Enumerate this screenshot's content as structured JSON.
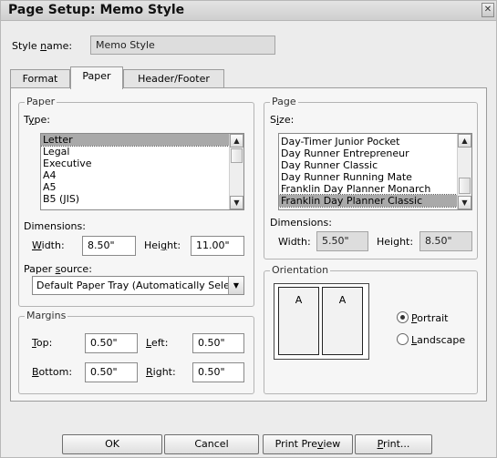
{
  "window": {
    "title": "Page Setup: Memo Style",
    "close_glyph": "✕"
  },
  "style_name": {
    "label_pre": "Style ",
    "label_u": "n",
    "label_post": "ame:",
    "value": "Memo Style"
  },
  "tabs": [
    {
      "label": "Format"
    },
    {
      "label": "Paper"
    },
    {
      "label": "Header/Footer"
    }
  ],
  "paper_group": {
    "legend": "Paper",
    "type_label_pre": "T",
    "type_label_u": "y",
    "type_label_post": "pe:",
    "type_items": [
      "Letter",
      "Legal",
      "Executive",
      "A4",
      "A5",
      "B5 (JIS)"
    ],
    "type_selected_index": 0,
    "dimensions_label": "Dimensions:",
    "width_label_u": "W",
    "width_label_post": "idth:",
    "width_value": "8.50\"",
    "height_label_pre": "Hei",
    "height_label_u": "g",
    "height_label_post": "ht:",
    "height_value": "11.00\"",
    "source_label_pre": "Paper ",
    "source_label_u": "s",
    "source_label_post": "ource:",
    "source_value": "Default Paper Tray (Automatically Sele"
  },
  "margins_group": {
    "legend": "Margins",
    "top_label_u": "T",
    "top_label_post": "op:",
    "top_value": "0.50\"",
    "left_label_u": "L",
    "left_label_post": "eft:",
    "left_value": "0.50\"",
    "bottom_label_u": "B",
    "bottom_label_post": "ottom:",
    "bottom_value": "0.50\"",
    "right_label_u": "R",
    "right_label_post": "ight:",
    "right_value": "0.50\""
  },
  "page_group": {
    "legend": "Page",
    "size_label_pre": "S",
    "size_label_u": "i",
    "size_label_post": "ze:",
    "size_items": [
      "Day-Timer Junior Pocket",
      "Day Runner Entrepreneur",
      "Day Runner Classic",
      "Day Runner Running Mate",
      "Franklin Day Planner Monarch",
      "Franklin Day Planner Classic"
    ],
    "size_selected_index": 5,
    "dimensions_label": "Dimensions:",
    "width_label": "Width:",
    "width_value": "5.50\"",
    "height_label": "Height:",
    "height_value": "8.50\""
  },
  "orientation_group": {
    "legend": "Orientation",
    "preview_letter_left": "A",
    "preview_letter_right": "A",
    "portrait_label_u": "P",
    "portrait_label_post": "ortrait",
    "landscape_label_u": "L",
    "landscape_label_post": "andscape",
    "selected": "portrait"
  },
  "buttons": {
    "ok": "OK",
    "cancel": "Cancel",
    "print_preview_pre": "Print Pre",
    "print_preview_u": "v",
    "print_preview_post": "iew",
    "print_u": "P",
    "print_post": "rint..."
  },
  "icons": {
    "scroll_up": "▲",
    "scroll_down": "▼",
    "dropdown": "▼"
  }
}
